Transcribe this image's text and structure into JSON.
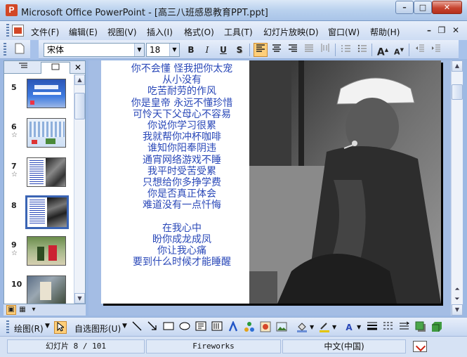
{
  "window": {
    "title": "Microsoft Office PowerPoint - [高三八班感恩教育PPT.ppt]",
    "controls": {
      "minimize": "–",
      "maximize": "□",
      "close": "✕"
    }
  },
  "menu": {
    "items": [
      "文件(F)",
      "编辑(E)",
      "视图(V)",
      "插入(I)",
      "格式(O)",
      "工具(T)",
      "幻灯片放映(D)",
      "窗口(W)",
      "帮助(H)"
    ],
    "doc_controls": {
      "minimize": "–",
      "restore": "❐",
      "close": "✕"
    }
  },
  "format_toolbar": {
    "font_name": "宋体",
    "font_size": "18",
    "bold": "B",
    "italic": "I",
    "underline": "U",
    "shadow": "S",
    "active_alignment": "align-left"
  },
  "slide_panel": {
    "tabs": {
      "outline_icon": "outline-icon",
      "slides_icon": "slides-icon"
    },
    "close": "✕",
    "slides": [
      {
        "number": "5",
        "has_anim": false,
        "selected": false
      },
      {
        "number": "6",
        "has_anim": true,
        "selected": false
      },
      {
        "number": "7",
        "has_anim": true,
        "selected": false
      },
      {
        "number": "8",
        "has_anim": false,
        "selected": true
      },
      {
        "number": "9",
        "has_anim": true,
        "selected": false
      },
      {
        "number": "10",
        "has_anim": false,
        "selected": false
      }
    ],
    "anim_marker": "☆"
  },
  "slide": {
    "poem_lines": [
      "你不会懂  怪我把你太宠",
      "从小没有",
      "吃苦耐劳的作风",
      "你是皇帝  永远不懂珍惜",
      "可怜天下父母心不容易",
      "你说你学习很累",
      "我就帮你冲杯咖啡",
      "谁知你阳奉阴违",
      "通宵网络游戏不睡",
      "我平时受苦受累",
      "只想给你多挣学费",
      "你是否真正体会",
      "难道没有一点忏悔",
      "",
      "在我心中",
      "盼你成龙成凤",
      "你让我心痛",
      "要到什么时候才能睡醒"
    ],
    "text_color": "#2a48b8"
  },
  "draw_toolbar": {
    "draw_label": "绘图(R)",
    "autoshapes_label": "自选图形(U)"
  },
  "status": {
    "slide_info": "幻灯片 8 / 101",
    "design": "Fireworks",
    "language": "中文(中国)"
  },
  "colors": {
    "titlebar": "#b9d1ee",
    "slide_bg": "#ffffff",
    "accent_select": "#3a64b4",
    "active_button": "#ffcf7a"
  }
}
